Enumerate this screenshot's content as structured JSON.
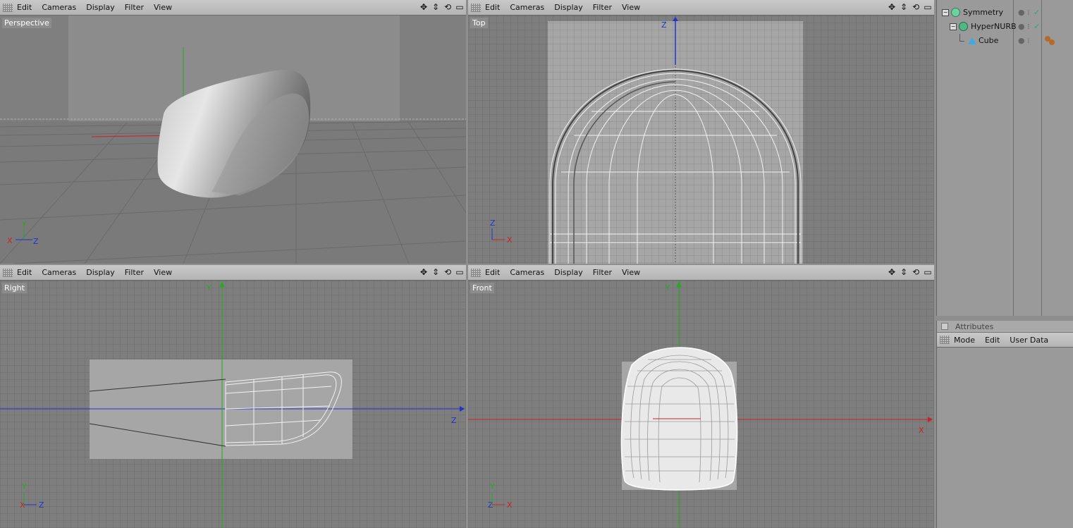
{
  "viewport_menu": [
    "Edit",
    "Cameras",
    "Display",
    "Filter",
    "View"
  ],
  "viewports": {
    "perspective": {
      "label": "Perspective"
    },
    "top": {
      "label": "Top"
    },
    "right": {
      "label": "Right"
    },
    "front": {
      "label": "Front"
    }
  },
  "axis_labels": {
    "x": "X",
    "y": "Y",
    "z": "Z"
  },
  "objects": [
    {
      "name": "Symmetry",
      "icon": "symmetry-icon"
    },
    {
      "name": "HyperNURB",
      "icon": "hypernurbs-icon"
    },
    {
      "name": "Cube",
      "icon": "cube-icon"
    }
  ],
  "attributes": {
    "title": "Attributes",
    "menu": [
      "Mode",
      "Edit",
      "User Data"
    ]
  },
  "colors": {
    "x_axis": "#cc2222",
    "y_axis": "#22aa22",
    "z_axis": "#2233cc",
    "bg": "#7e7e7e"
  }
}
